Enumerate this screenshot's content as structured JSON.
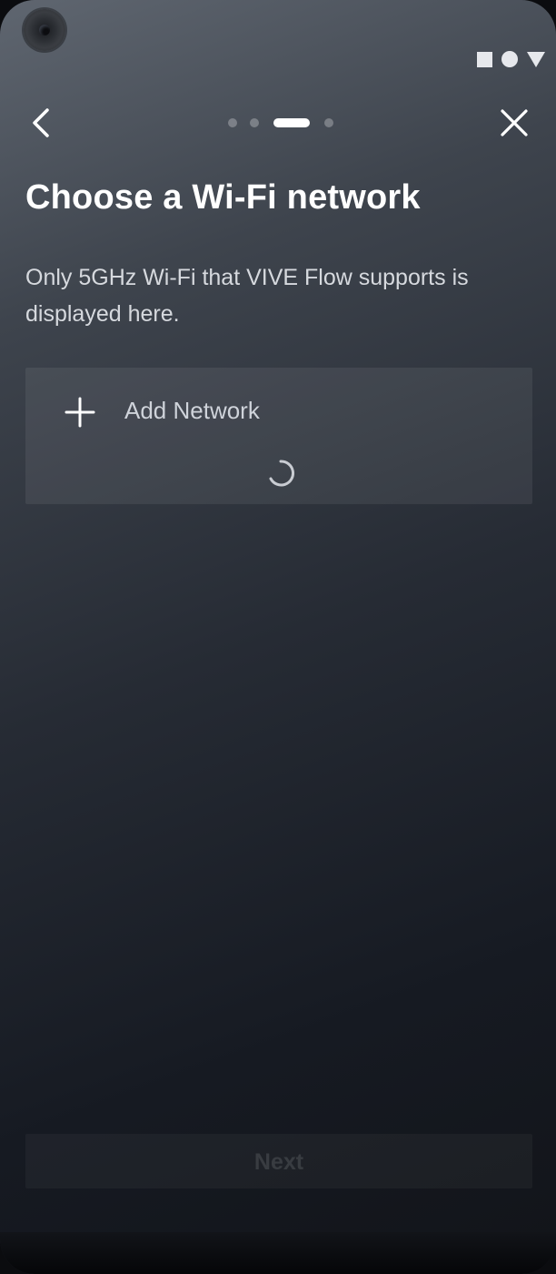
{
  "status_bar": {
    "icons": [
      "square-icon",
      "circle-icon",
      "triangle-icon"
    ]
  },
  "header": {
    "back_icon": "chevron-left-icon",
    "close_icon": "close-icon",
    "pager": {
      "total_steps": 4,
      "current_step": 3
    }
  },
  "main": {
    "title": "Choose a Wi-Fi network",
    "description": "Only 5GHz Wi-Fi that VIVE Flow supports is displayed here.",
    "network_list": {
      "add_network_label": "Add Network",
      "add_icon": "plus-icon",
      "loading": true
    }
  },
  "footer": {
    "next_label": "Next",
    "next_enabled": false
  },
  "colors": {
    "text_primary": "#ffffff",
    "text_secondary": "#d6d9de",
    "card_background": "rgba(255,255,255,0.07)"
  }
}
